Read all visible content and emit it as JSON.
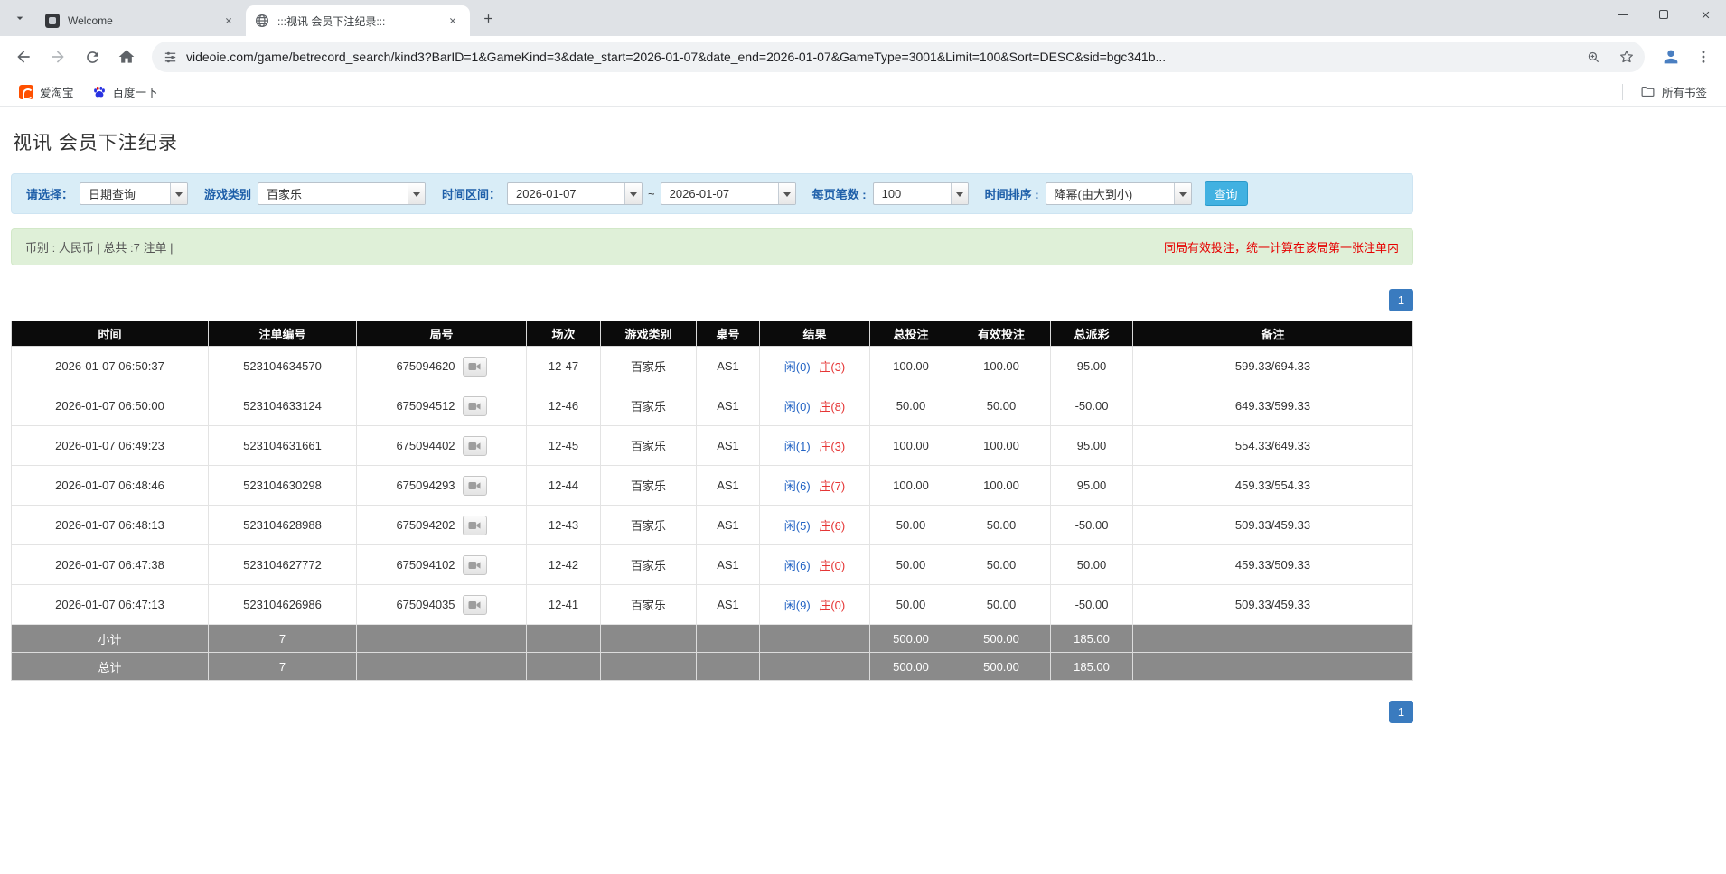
{
  "browser": {
    "tabs": [
      {
        "title": "Welcome"
      },
      {
        "title": ":::视讯 会员下注纪录:::"
      }
    ],
    "url": "videoie.com/game/betrecord_search/kind3?BarID=1&GameKind=3&date_start=2026-01-07&date_end=2026-01-07&GameType=3001&Limit=100&Sort=DESC&sid=bgc341b...",
    "bookmarks": [
      {
        "label": "爱淘宝",
        "icon": "taobao-icon"
      },
      {
        "label": "百度一下",
        "icon": "baidu-paw-icon"
      }
    ],
    "all_bookmarks_label": "所有书签"
  },
  "page": {
    "title": "视讯 会员下注纪录",
    "filter": {
      "select_label": "请选择：",
      "select_value": "日期查询",
      "game_type_label": "游戏类别",
      "game_type_value": "百家乐",
      "date_range_label": "时间区间：",
      "date_start": "2026-01-07",
      "range_separator": "~",
      "date_end": "2026-01-07",
      "page_size_label": "每页笔数 :",
      "page_size_value": "100",
      "sort_label": "时间排序 :",
      "sort_value": "降幂(由大到小)",
      "search_button": "查询"
    },
    "summary": {
      "left": "币别 : 人民币 | 总共 :7 注单 |",
      "notice": "同局有效投注，统一计算在该局第一张注单内"
    },
    "pagination": {
      "page": "1"
    },
    "table": {
      "headers": [
        "时间",
        "注单编号",
        "局号",
        "场次",
        "游戏类别",
        "桌号",
        "结果",
        "总投注",
        "有效投注",
        "总派彩",
        "备注"
      ],
      "rows": [
        {
          "time": "2026-01-07 06:50:37",
          "bet_id": "523104634570",
          "round_id": "675094620",
          "session": "12-47",
          "game_type": "百家乐",
          "table_no": "AS1",
          "result_player": "闲(0)",
          "result_banker": "庄(3)",
          "total_bet": "100.00",
          "valid_bet": "100.00",
          "payout": "95.00",
          "note": "599.33/694.33"
        },
        {
          "time": "2026-01-07 06:50:00",
          "bet_id": "523104633124",
          "round_id": "675094512",
          "session": "12-46",
          "game_type": "百家乐",
          "table_no": "AS1",
          "result_player": "闲(0)",
          "result_banker": "庄(8)",
          "total_bet": "50.00",
          "valid_bet": "50.00",
          "payout": "-50.00",
          "note": "649.33/599.33"
        },
        {
          "time": "2026-01-07 06:49:23",
          "bet_id": "523104631661",
          "round_id": "675094402",
          "session": "12-45",
          "game_type": "百家乐",
          "table_no": "AS1",
          "result_player": "闲(1)",
          "result_banker": "庄(3)",
          "total_bet": "100.00",
          "valid_bet": "100.00",
          "payout": "95.00",
          "note": "554.33/649.33"
        },
        {
          "time": "2026-01-07 06:48:46",
          "bet_id": "523104630298",
          "round_id": "675094293",
          "session": "12-44",
          "game_type": "百家乐",
          "table_no": "AS1",
          "result_player": "闲(6)",
          "result_banker": "庄(7)",
          "total_bet": "100.00",
          "valid_bet": "100.00",
          "payout": "95.00",
          "note": "459.33/554.33"
        },
        {
          "time": "2026-01-07 06:48:13",
          "bet_id": "523104628988",
          "round_id": "675094202",
          "session": "12-43",
          "game_type": "百家乐",
          "table_no": "AS1",
          "result_player": "闲(5)",
          "result_banker": "庄(6)",
          "total_bet": "50.00",
          "valid_bet": "50.00",
          "payout": "-50.00",
          "note": "509.33/459.33"
        },
        {
          "time": "2026-01-07 06:47:38",
          "bet_id": "523104627772",
          "round_id": "675094102",
          "session": "12-42",
          "game_type": "百家乐",
          "table_no": "AS1",
          "result_player": "闲(6)",
          "result_banker": "庄(0)",
          "total_bet": "50.00",
          "valid_bet": "50.00",
          "payout": "50.00",
          "note": "459.33/509.33"
        },
        {
          "time": "2026-01-07 06:47:13",
          "bet_id": "523104626986",
          "round_id": "675094035",
          "session": "12-41",
          "game_type": "百家乐",
          "table_no": "AS1",
          "result_player": "闲(9)",
          "result_banker": "庄(0)",
          "total_bet": "50.00",
          "valid_bet": "50.00",
          "payout": "-50.00",
          "note": "509.33/459.33"
        }
      ],
      "subtotal": {
        "label": "小计",
        "count": "7",
        "total_bet": "500.00",
        "valid_bet": "500.00",
        "payout": "185.00"
      },
      "total": {
        "label": "总计",
        "count": "7",
        "total_bet": "500.00",
        "valid_bet": "500.00",
        "payout": "185.00"
      }
    },
    "colors": {
      "accent_blue": "#2a6db5",
      "player_blue": "#2263c4",
      "banker_red": "#e53535",
      "negative_red": "#ee1111",
      "notice_red": "#e60000",
      "filter_bar_bg": "#d9edf7",
      "summary_bar_bg": "#dff0d8",
      "table_header_bg": "#0b0b0b",
      "summary_row_bg": "#8a8a8a",
      "pager_bg": "#3a7bbf",
      "search_button_bg": "#41b1e1"
    }
  }
}
